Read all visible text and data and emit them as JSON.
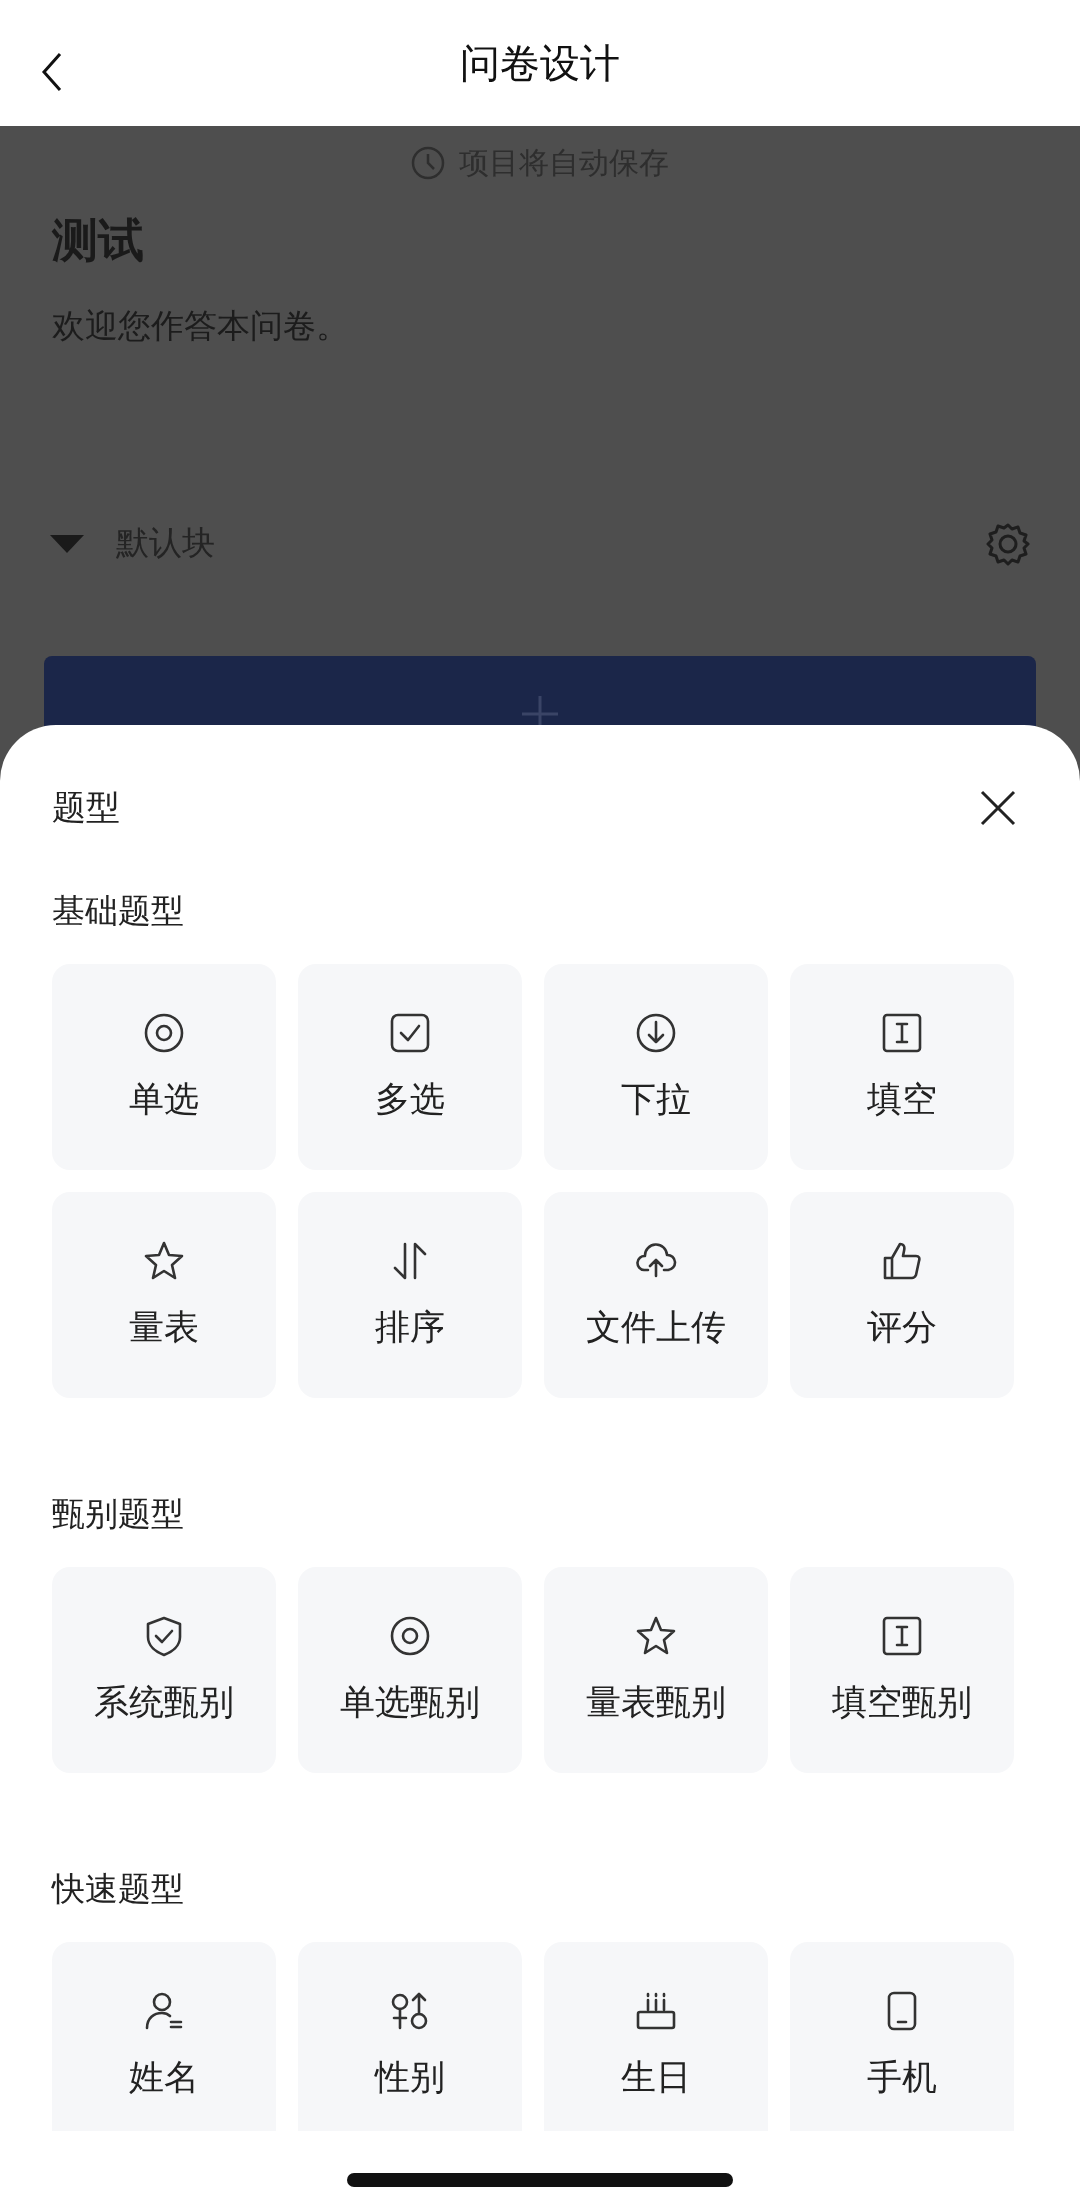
{
  "header": {
    "title": "问卷设计"
  },
  "page": {
    "autosave": "项目将自动保存",
    "survey_title": "测试",
    "description": "欢迎您作答本问卷。",
    "block": {
      "name": "默认块",
      "expanded": true
    }
  },
  "sheet": {
    "title": "题型",
    "sections": [
      {
        "heading": "基础题型",
        "items": [
          {
            "label": "单选",
            "kind": "radio"
          },
          {
            "label": "多选",
            "kind": "checkbox"
          },
          {
            "label": "下拉",
            "kind": "dropdown"
          },
          {
            "label": "填空",
            "kind": "text"
          },
          {
            "label": "量表",
            "kind": "star"
          },
          {
            "label": "排序",
            "kind": "sort"
          },
          {
            "label": "文件上传",
            "kind": "upload"
          },
          {
            "label": "评分",
            "kind": "thumb"
          }
        ]
      },
      {
        "heading": "甄别题型",
        "items": [
          {
            "label": "系统甄别",
            "kind": "shield"
          },
          {
            "label": "单选甄别",
            "kind": "radio"
          },
          {
            "label": "量表甄别",
            "kind": "star"
          },
          {
            "label": "填空甄别",
            "kind": "text"
          }
        ]
      },
      {
        "heading": "快速题型",
        "items": [
          {
            "label": "姓名",
            "kind": "person"
          },
          {
            "label": "性别",
            "kind": "gender"
          },
          {
            "label": "生日",
            "kind": "cake"
          },
          {
            "label": "手机",
            "kind": "phone"
          }
        ]
      }
    ]
  }
}
